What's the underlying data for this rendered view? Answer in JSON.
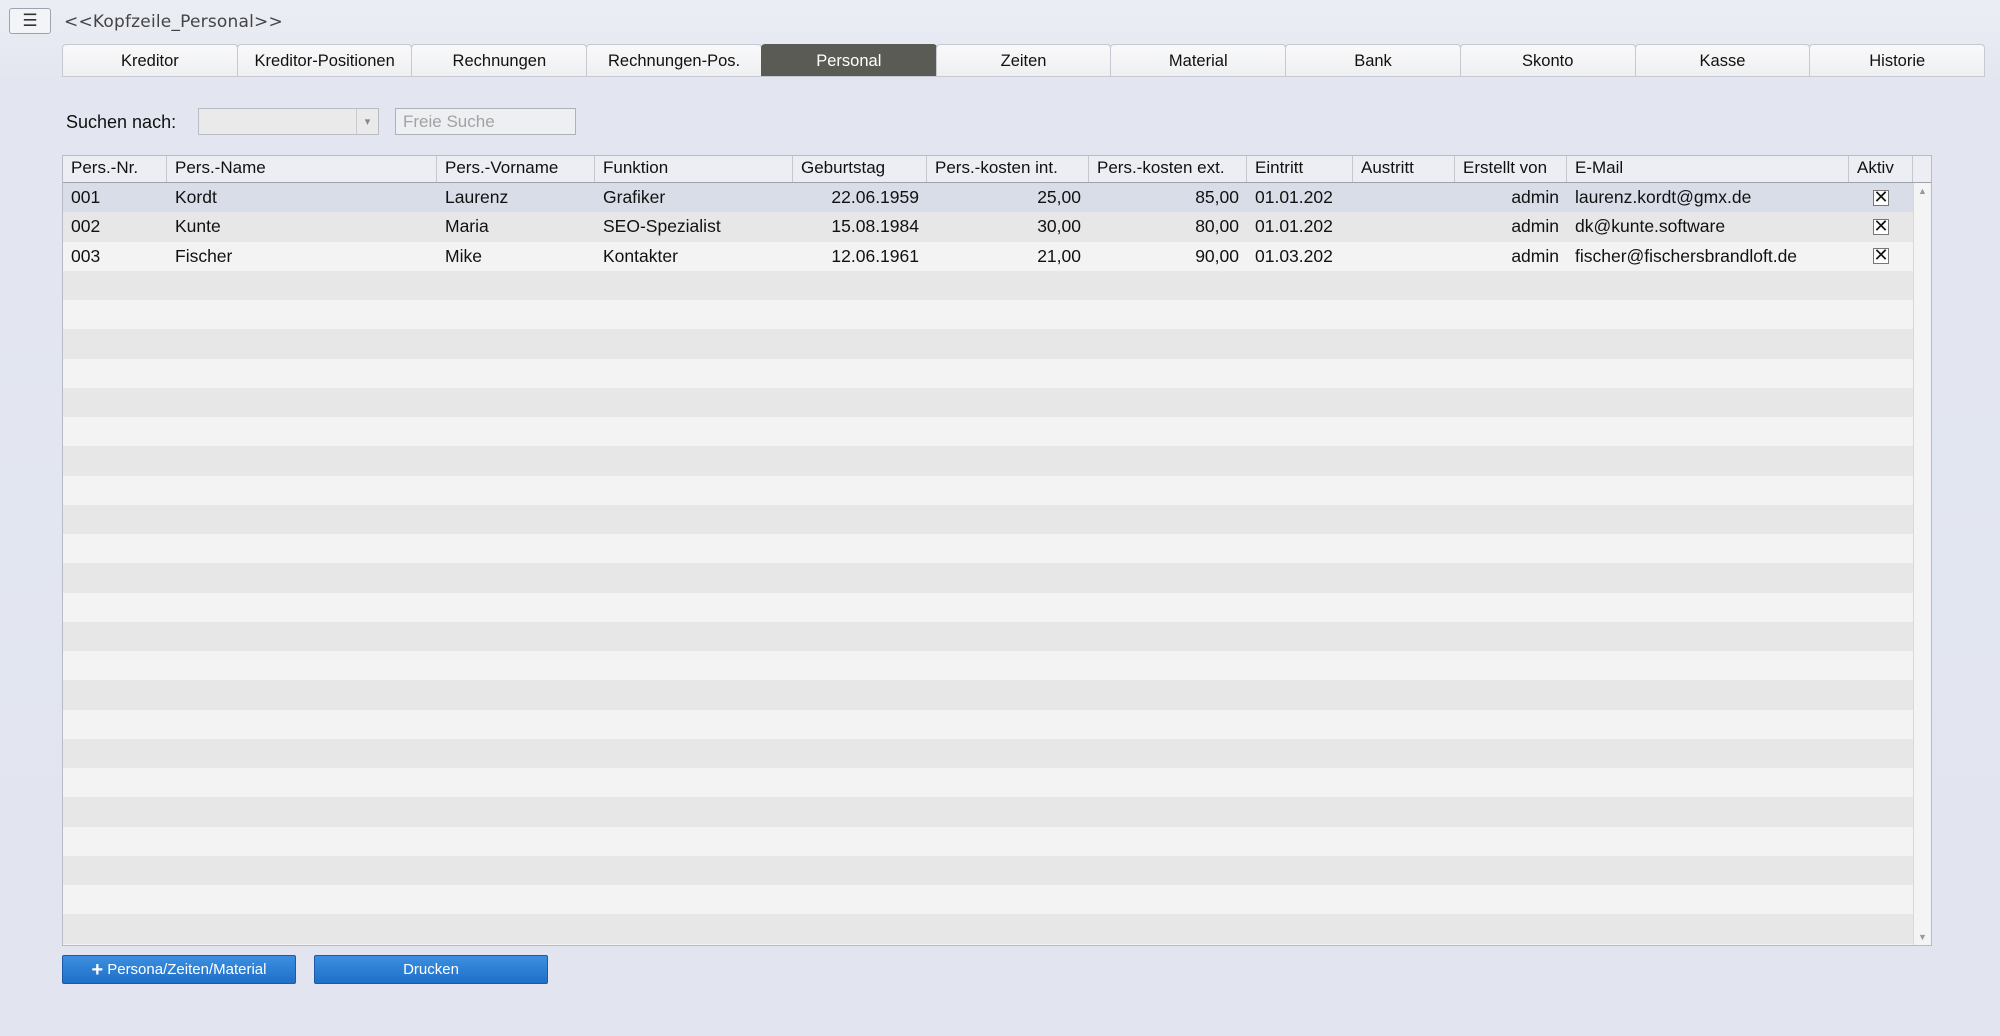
{
  "header": {
    "title": "<<Kopfzeile_Personal>>",
    "menu_icon": "list-icon"
  },
  "tabs": [
    {
      "label": "Kreditor",
      "active": false
    },
    {
      "label": "Kreditor-Positionen",
      "active": false
    },
    {
      "label": "Rechnungen",
      "active": false
    },
    {
      "label": "Rechnungen-Pos.",
      "active": false
    },
    {
      "label": "Personal",
      "active": true
    },
    {
      "label": "Zeiten",
      "active": false
    },
    {
      "label": "Material",
      "active": false
    },
    {
      "label": "Bank",
      "active": false
    },
    {
      "label": "Skonto",
      "active": false
    },
    {
      "label": "Kasse",
      "active": false
    },
    {
      "label": "Historie",
      "active": false
    }
  ],
  "search": {
    "label": "Suchen nach:",
    "select_value": "",
    "placeholder": "Freie Suche",
    "value": ""
  },
  "table": {
    "columns": [
      {
        "label": "Pers.-Nr."
      },
      {
        "label": "Pers.-Name"
      },
      {
        "label": "Pers.-Vorname"
      },
      {
        "label": "Funktion"
      },
      {
        "label": "Geburtstag"
      },
      {
        "label": "Pers.-kosten int."
      },
      {
        "label": "Pers.-kosten ext."
      },
      {
        "label": "Eintritt"
      },
      {
        "label": "Austritt"
      },
      {
        "label": "Erstellt von"
      },
      {
        "label": "E-Mail"
      },
      {
        "label": "Aktiv"
      }
    ],
    "rows": [
      [
        "001",
        "Kordt",
        "Laurenz",
        "Grafiker",
        "22.06.1959",
        "25,00",
        "85,00",
        "01.01.202",
        "",
        "admin",
        "laurenz.kordt@gmx.de",
        true
      ],
      [
        "002",
        "Kunte",
        "Maria",
        "SEO-Spezialist",
        "15.08.1984",
        "30,00",
        "80,00",
        "01.01.202",
        "",
        "admin",
        "dk@kunte.software",
        true
      ],
      [
        "003",
        "Fischer",
        "Mike",
        "Kontakter",
        "12.06.1961",
        "21,00",
        "90,00",
        "01.03.202",
        "",
        "admin",
        "fischer@fischersbrandloft.de",
        true
      ]
    ],
    "selected_row": 0,
    "empty_rows": 23
  },
  "buttons": {
    "add_label": "Persona/Zeiten/Material",
    "print_label": "Drucken"
  },
  "colors": {
    "active_tab": "#5b5b55",
    "button": "#2b7fd6",
    "selected_row": "#d9dde8"
  }
}
